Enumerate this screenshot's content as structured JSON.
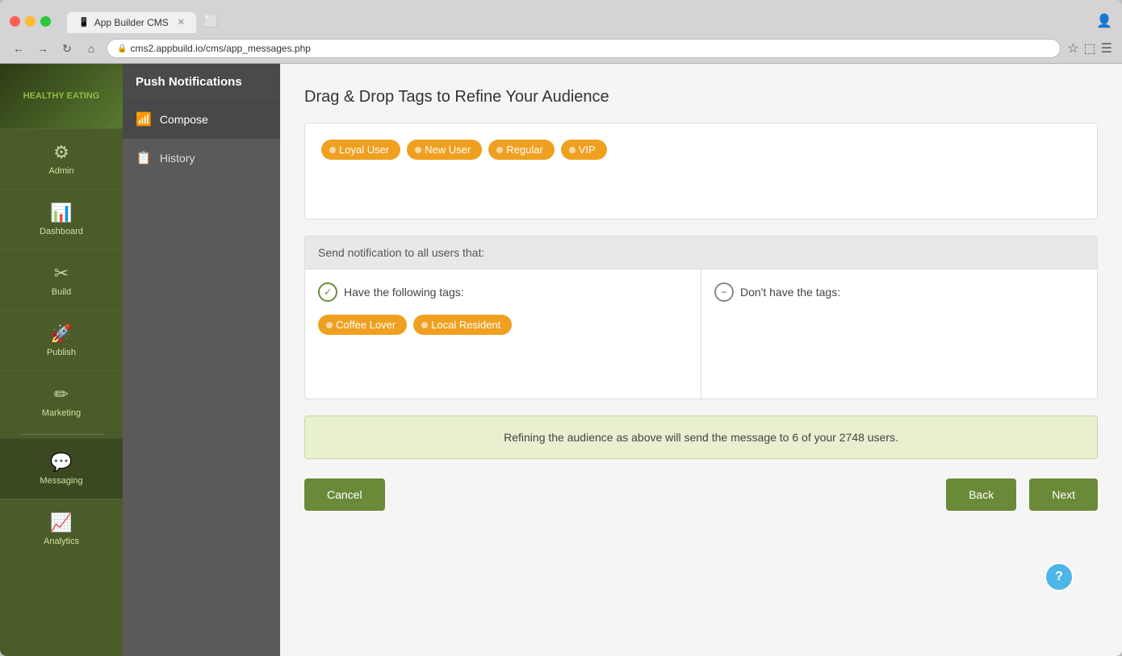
{
  "browser": {
    "tab_title": "App Builder CMS",
    "url": "cms2.appbuild.io/cms/app_messages.php",
    "favicon": "📱"
  },
  "sidebar_left": {
    "logo_text": "HEALTHY\nEATING",
    "nav_items": [
      {
        "id": "admin",
        "label": "Admin",
        "icon": "⚙"
      },
      {
        "id": "dashboard",
        "label": "Dashboard",
        "icon": "📊"
      },
      {
        "id": "build",
        "label": "Build",
        "icon": "🔧"
      },
      {
        "id": "publish",
        "label": "Publish",
        "icon": "🚀"
      },
      {
        "id": "marketing",
        "label": "Marketing",
        "icon": "📣"
      },
      {
        "id": "messaging",
        "label": "Messaging",
        "icon": "💬",
        "active": true
      },
      {
        "id": "analytics",
        "label": "Analytics",
        "icon": "📈"
      }
    ]
  },
  "sidebar_second": {
    "header": "Push Notifications",
    "nav_items": [
      {
        "id": "compose",
        "label": "Compose",
        "icon": "📶",
        "active": true
      },
      {
        "id": "history",
        "label": "History",
        "icon": "📋"
      }
    ]
  },
  "main": {
    "page_title": "Drag & Drop Tags to Refine Your Audience",
    "available_tags": [
      {
        "id": "loyal_user",
        "label": "Loyal User"
      },
      {
        "id": "new_user",
        "label": "New User"
      },
      {
        "id": "regular",
        "label": "Regular"
      },
      {
        "id": "vip",
        "label": "VIP"
      }
    ],
    "notification_header": "Send notification to all users that:",
    "have_tags_label": "Have the following tags:",
    "dont_have_tags_label": "Don't have the tags:",
    "have_tags": [
      {
        "id": "coffee_lover",
        "label": "Coffee Lover"
      },
      {
        "id": "local_resident",
        "label": "Local Resident"
      }
    ],
    "dont_have_tags": [],
    "audience_info": "Refining the audience as above will send the message to 6 of your 2748 users.",
    "cancel_label": "Cancel",
    "back_label": "Back",
    "next_label": "Next",
    "help_label": "?"
  }
}
